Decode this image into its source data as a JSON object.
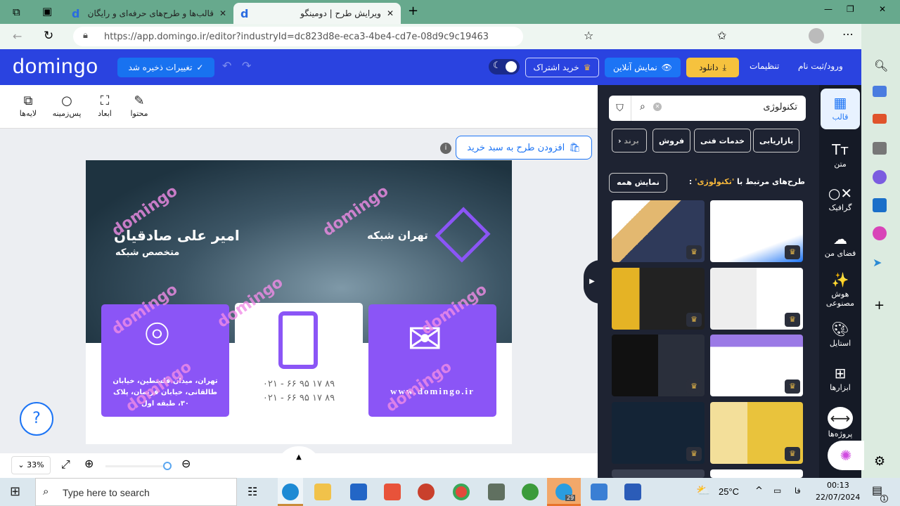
{
  "browser": {
    "tabs": [
      {
        "title": "قالب‌ها و طرح‌های حرفه‌ای و رایگان"
      },
      {
        "title": "ویرایش طرح | دومینگو",
        "active": true
      }
    ],
    "url": "https://app.domingo.ir/editor?industryId=dc823d8e-eca3-4be4-cd7e-08d9c9c19463"
  },
  "header": {
    "logo": "domingo",
    "saved": "تغییرات ذخیره شد",
    "subscribe": "خرید اشتراک",
    "preview": "نمایش آنلاین",
    "download": "دانلود",
    "settings": "تنظیمات",
    "login": "ورود/ثبت نام",
    "brand_color": "#2a43e0"
  },
  "toolbar": {
    "content": "محتوا",
    "dimensions": "ابعاد",
    "background": "پس‌زمینه",
    "layers": "لایه‌ها",
    "add_to_cart": "افزودن طرح به سبد خرید"
  },
  "card": {
    "name": "امیر علی صادقیان",
    "title": "متخصص شبکه",
    "company": "تهران شبکه",
    "address": "تهران، میدان فلسطین، خیابان طالقانی، خیابان فریمان، پلاک ۳۰، طبقه اول",
    "phone1": "۰۲۱ - ۶۶ ۹۵ ۱۷ ۸۹",
    "phone2": "۰۲۱ - ۶۶ ۹۵ ۱۷ ۸۹",
    "website": "www.domingo.ir",
    "watermark": "domingo",
    "accent": "#8b55f6"
  },
  "zoom": {
    "level": "33%"
  },
  "panel": {
    "search_value": "تکنولوژی",
    "chips": [
      "بازاریابی",
      "خدمات فنی",
      "فروش",
      "برند"
    ],
    "related_prefix": "طرح‌های مرتبط با",
    "related_term": "'تکنولوژی'",
    "show_all": "نمایش همه"
  },
  "sidebar": {
    "items": [
      {
        "label": "قالب",
        "icon": "template-icon"
      },
      {
        "label": "متن",
        "icon": "text-icon"
      },
      {
        "label": "گرافیک",
        "icon": "shapes-icon"
      },
      {
        "label": "فضای من",
        "icon": "cloud-upload-icon"
      },
      {
        "label": "هوش مصنوعی",
        "icon": "magic-wand-icon"
      },
      {
        "label": "استایل",
        "icon": "palette-icon"
      },
      {
        "label": "ابزارها",
        "icon": "apps-icon"
      },
      {
        "label": "پروژه‌ها",
        "icon": "translate-icon"
      }
    ]
  },
  "taskbar": {
    "search_placeholder": "Type here to search",
    "weather": "25°C",
    "lang": "فا",
    "time": "00:13",
    "date": "22/07/2024",
    "telegram_badge": "29",
    "notif": "1"
  }
}
